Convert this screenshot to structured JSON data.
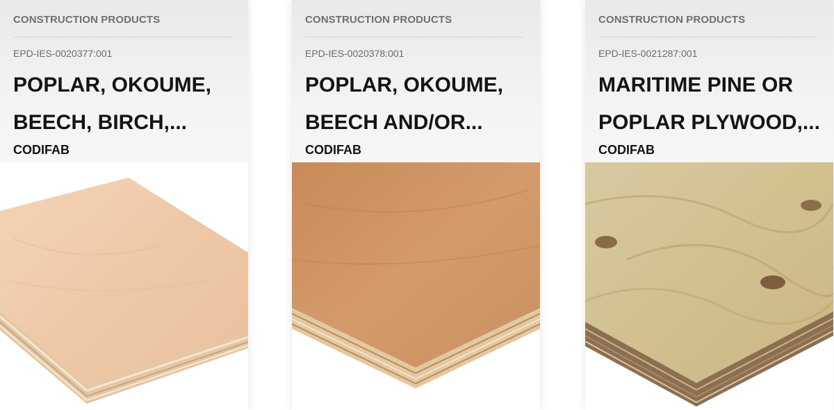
{
  "cards": [
    {
      "category": "CONSTRUCTION PRODUCTS",
      "epd_id": "EPD-IES-0020377:001",
      "title_line1": "POPLAR, OKOUME,",
      "title_line2": "BEECH, BIRCH,...",
      "brand": "CODIFAB",
      "image": "light-plywood-board-image"
    },
    {
      "category": "CONSTRUCTION PRODUCTS",
      "epd_id": "EPD-IES-0020378:001",
      "title_line1": "POPLAR, OKOUME,",
      "title_line2": "BEECH AND/OR...",
      "brand": "CODIFAB",
      "image": "okoume-plywood-board-image"
    },
    {
      "category": "CONSTRUCTION PRODUCTS",
      "epd_id": "EPD-IES-0021287:001",
      "title_line1": "MARITIME PINE OR",
      "title_line2": "POPLAR PLYWOOD,...",
      "brand": "CODIFAB",
      "image": "pine-plywood-board-image"
    }
  ]
}
